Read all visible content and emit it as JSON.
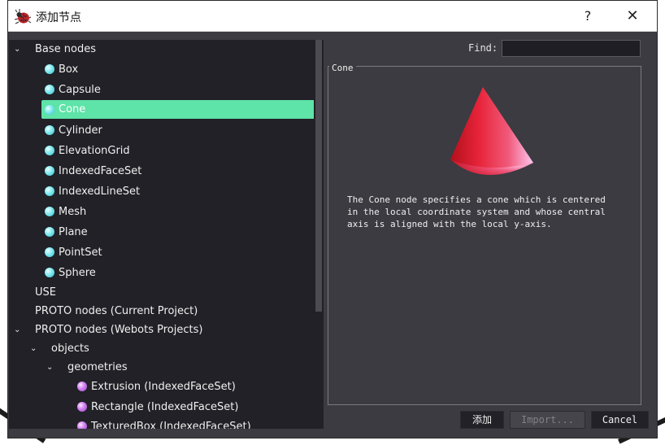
{
  "window": {
    "title": "添加节点",
    "help_label": "?",
    "close_label": "✕"
  },
  "tree": {
    "base_nodes": {
      "label": "Base nodes",
      "items": [
        {
          "label": "Box"
        },
        {
          "label": "Capsule"
        },
        {
          "label": "Cone",
          "selected": true
        },
        {
          "label": "Cylinder"
        },
        {
          "label": "ElevationGrid"
        },
        {
          "label": "IndexedFaceSet"
        },
        {
          "label": "IndexedLineSet"
        },
        {
          "label": "Mesh"
        },
        {
          "label": "Plane"
        },
        {
          "label": "PointSet"
        },
        {
          "label": "Sphere"
        }
      ]
    },
    "use_label": "USE",
    "proto_current_label": "PROTO nodes (Current Project)",
    "proto_webots_label": "PROTO nodes (Webots Projects)",
    "objects_label": "objects",
    "geometries_label": "geometries",
    "geometry_items": [
      {
        "label": "Extrusion (IndexedFaceSet)"
      },
      {
        "label": "Rectangle (IndexedFaceSet)"
      },
      {
        "label": "TexturedBox (IndexedFaceSet)"
      }
    ]
  },
  "find": {
    "label": "Find:",
    "value": ""
  },
  "preview": {
    "group_title": "Cone",
    "description": "The Cone node specifies a cone which is centered\nin the local coordinate system and whose central\naxis is aligned with the local y-axis."
  },
  "buttons": {
    "add_label": "添加",
    "import_label": "Import...",
    "cancel_label": "Cancel"
  },
  "colors": {
    "selection": "#5ee3a8",
    "background": "#3b3b41",
    "tree_background": "#212127"
  },
  "icons": {
    "title": "bug-icon",
    "expand": "chevron-down-icon",
    "base_node": "cyan-sphere-icon",
    "proto_node": "violet-sphere-icon"
  }
}
